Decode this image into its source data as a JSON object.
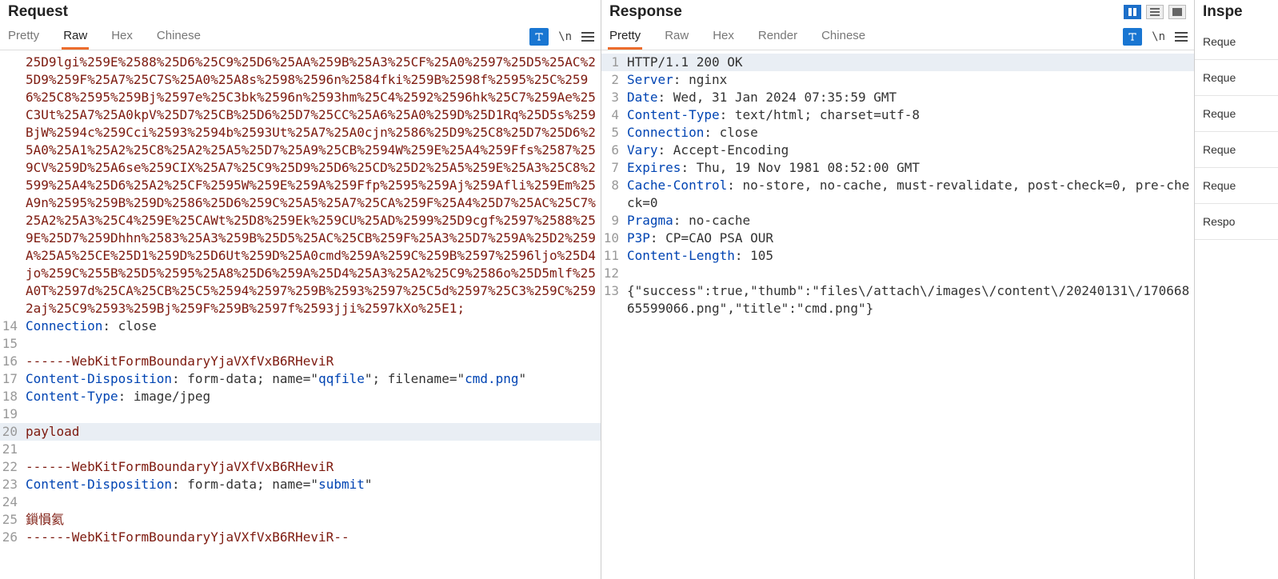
{
  "request": {
    "title": "Request",
    "tabs": [
      "Pretty",
      "Raw",
      "Hex",
      "Chinese"
    ],
    "active_tab": 1,
    "wrap_label": "\\n",
    "url_encoded_fragment": "25D9lgi%259E%2588%25D6%25C9%25D6%25AA%259B%25A3%25CF%25A0%2597%25D5%25AC%25D9%259F%25A7%25C7S%25A0%25A8s%2598%2596n%2584fki%259B%2598f%2595%25C%2596%25C8%2595%259Bj%2597e%25C3bk%2596n%2593hm%25C4%2592%2596hk%25C7%259Ae%25C3Ut%25A7%25A0kpV%25D7%25CB%25D6%25D7%25CC%25A6%25A0%259D%25D1Rq%25D5s%259BjW%2594c%259Cci%2593%2594b%2593Ut%25A7%25A0cjn%2586%25D9%25C8%25D7%25D6%25A0%25A1%25A2%25C8%25A2%25A5%25D7%25A9%25CB%2594W%259E%25A4%259Ffs%2587%259CV%259D%25A6se%259CIX%25A7%25C9%25D9%25D6%25CD%25D2%25A5%259E%25A3%25C8%2599%25A4%25D6%25A2%25CF%2595W%259E%259A%259Ffp%2595%259Aj%259Afli%259Em%25A9n%2595%259B%259D%2586%25D6%259C%25A5%25A7%25CA%259F%25A4%25D7%25AC%25C7%25A2%25A3%25C4%259E%25CAWt%25D8%259Ek%259CU%25AD%2599%25D9cgf%2597%2588%259E%25D7%259Dhhn%2583%25A3%259B%25D5%25AC%25CB%259F%25A3%25D7%259A%25D2%259A%25A5%25CE%25D1%259D%25D6Ut%259D%25A0cmd%259A%259C%259B%2597%2596ljo%25D4jo%259C%255B%25D5%2595%25A8%25D6%259A%25D4%25A3%25A2%25C9%2586o%25D5mlf%25A0T%2597d%25CA%25CB%25C5%2594%2597%259B%2593%2597%25C5d%2597%25C3%259C%2592aj%25C9%2593%259Bj%259F%259B%2597f%2593jji%2597kXo%25E1;",
    "lines": [
      {
        "n": 14,
        "parts": [
          {
            "t": "Connection",
            "c": "c-blue"
          },
          {
            "t": ": ",
            "c": "c-plain"
          },
          {
            "t": "close",
            "c": "c-plain"
          }
        ]
      },
      {
        "n": 15,
        "parts": []
      },
      {
        "n": 16,
        "parts": [
          {
            "t": "------WebKitFormBoundaryYjaVXfVxB6RHeviR",
            "c": "c-darkred"
          }
        ]
      },
      {
        "n": 17,
        "parts": [
          {
            "t": "Content-Disposition",
            "c": "c-blue"
          },
          {
            "t": ": form-data; name=\"",
            "c": "c-plain"
          },
          {
            "t": "qqfile",
            "c": "c-blue"
          },
          {
            "t": "\"; filename=\"",
            "c": "c-plain"
          },
          {
            "t": "cmd.png",
            "c": "c-blue"
          },
          {
            "t": "\"",
            "c": "c-plain"
          }
        ]
      },
      {
        "n": 18,
        "parts": [
          {
            "t": "Content-Type",
            "c": "c-blue"
          },
          {
            "t": ": image/jpeg",
            "c": "c-plain"
          }
        ]
      },
      {
        "n": 19,
        "parts": []
      },
      {
        "n": 20,
        "hl": true,
        "parts": [
          {
            "t": "payload",
            "c": "c-darkred"
          }
        ]
      },
      {
        "n": 21,
        "parts": []
      },
      {
        "n": 22,
        "parts": [
          {
            "t": "------WebKitFormBoundaryYjaVXfVxB6RHeviR",
            "c": "c-darkred"
          }
        ]
      },
      {
        "n": 23,
        "parts": [
          {
            "t": "Content-Disposition",
            "c": "c-blue"
          },
          {
            "t": ": form-data; name=\"",
            "c": "c-plain"
          },
          {
            "t": "submit",
            "c": "c-blue"
          },
          {
            "t": "\"",
            "c": "c-plain"
          }
        ]
      },
      {
        "n": 24,
        "parts": []
      },
      {
        "n": 25,
        "parts": [
          {
            "t": "鎻愪氦",
            "c": "c-darkred"
          }
        ]
      },
      {
        "n": 26,
        "parts": [
          {
            "t": "------WebKitFormBoundaryYjaVXfVxB6RHeviR--",
            "c": "c-darkred"
          }
        ]
      }
    ]
  },
  "response": {
    "title": "Response",
    "tabs": [
      "Pretty",
      "Raw",
      "Hex",
      "Render",
      "Chinese"
    ],
    "active_tab": 0,
    "wrap_label": "\\n",
    "lines": [
      {
        "n": 1,
        "hl": true,
        "parts": [
          {
            "t": "HTTP/1.1 200 OK",
            "c": "c-plain"
          }
        ]
      },
      {
        "n": 2,
        "parts": [
          {
            "t": "Server",
            "c": "c-blue"
          },
          {
            "t": ": nginx",
            "c": "c-plain"
          }
        ]
      },
      {
        "n": 3,
        "parts": [
          {
            "t": "Date",
            "c": "c-blue"
          },
          {
            "t": ": Wed, 31 Jan 2024 07:35:59 GMT",
            "c": "c-plain"
          }
        ]
      },
      {
        "n": 4,
        "parts": [
          {
            "t": "Content-Type",
            "c": "c-blue"
          },
          {
            "t": ": text/html; charset=utf-8",
            "c": "c-plain"
          }
        ]
      },
      {
        "n": 5,
        "parts": [
          {
            "t": "Connection",
            "c": "c-blue"
          },
          {
            "t": ": close",
            "c": "c-plain"
          }
        ]
      },
      {
        "n": 6,
        "parts": [
          {
            "t": "Vary",
            "c": "c-blue"
          },
          {
            "t": ": Accept-Encoding",
            "c": "c-plain"
          }
        ]
      },
      {
        "n": 7,
        "parts": [
          {
            "t": "Expires",
            "c": "c-blue"
          },
          {
            "t": ": Thu, 19 Nov 1981 08:52:00 GMT",
            "c": "c-plain"
          }
        ]
      },
      {
        "n": 8,
        "parts": [
          {
            "t": "Cache-Control",
            "c": "c-blue"
          },
          {
            "t": ": no-store, no-cache, must-revalidate, post-check=0, pre-check=0",
            "c": "c-plain"
          }
        ]
      },
      {
        "n": 9,
        "parts": [
          {
            "t": "Pragma",
            "c": "c-blue"
          },
          {
            "t": ": no-cache",
            "c": "c-plain"
          }
        ]
      },
      {
        "n": 10,
        "parts": [
          {
            "t": "P3P",
            "c": "c-blue"
          },
          {
            "t": ": CP=CAO PSA OUR",
            "c": "c-plain"
          }
        ]
      },
      {
        "n": 11,
        "parts": [
          {
            "t": "Content-Length",
            "c": "c-blue"
          },
          {
            "t": ": 105",
            "c": "c-plain"
          }
        ]
      },
      {
        "n": 12,
        "parts": []
      },
      {
        "n": 13,
        "parts": [
          {
            "t": "{\"success\":true,\"thumb\":\"files\\/attach\\/images\\/content\\/20240131\\/17066865599066.png\",\"title\":\"cmd.png\"}",
            "c": "c-plain"
          }
        ]
      }
    ]
  },
  "inspector": {
    "title": "Inspe",
    "items": [
      "Reque",
      "Reque",
      "Reque",
      "Reque",
      "Reque",
      "Respo"
    ]
  }
}
